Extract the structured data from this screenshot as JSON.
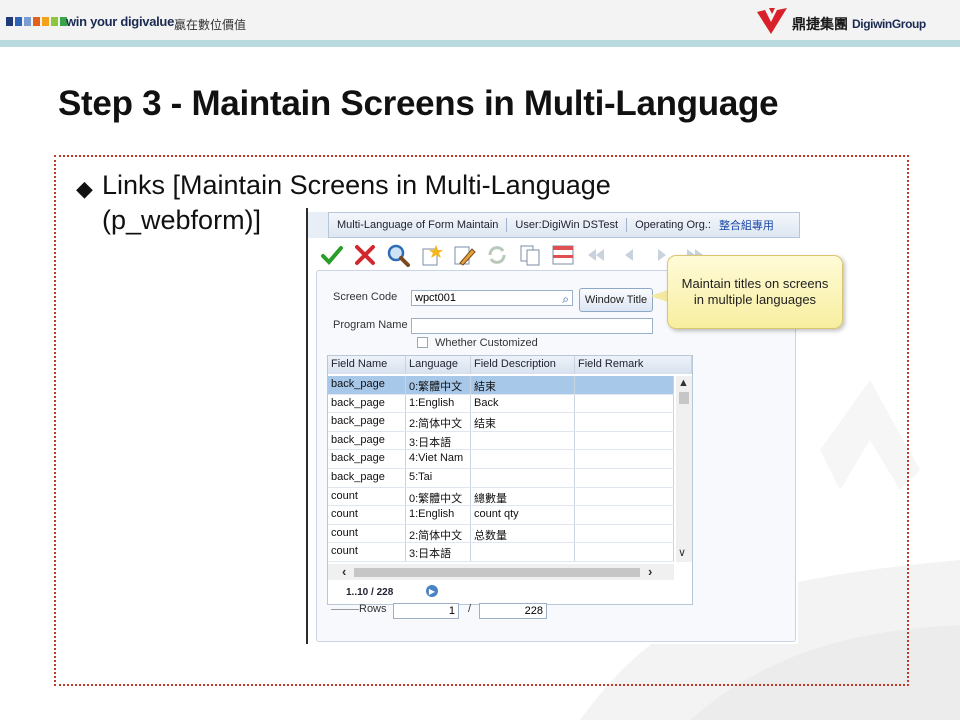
{
  "header": {
    "tagline": "win your digivalue",
    "tagline_cn": "贏在數位價值",
    "brand_cn": "鼎捷集團",
    "brand_en": "DigiwinGroup",
    "square_colors": [
      "#1e3a78",
      "#2f63b5",
      "#7a9ed3",
      "#e2611c",
      "#f4a21e",
      "#8cc63f",
      "#3ba34a"
    ]
  },
  "slide": {
    "title": "Step 3 - Maintain Screens in Multi-Language",
    "bullet_symbol": "◆",
    "bullet_text": "Links [Maintain Screens in Multi-Language (p_webform)]"
  },
  "app": {
    "header": {
      "title": "Multi-Language of Form Maintain",
      "user": "User:DigiWin DSTest",
      "org_label": "Operating Org.:",
      "org_value": "整合組專用"
    },
    "toolbar_icons": [
      "check-icon",
      "cross-icon",
      "search-icon",
      "new-icon",
      "edit-icon",
      "refresh-icon",
      "copy-icon",
      "grid-icon",
      "first-icon",
      "prev-icon",
      "next-icon",
      "last-icon"
    ],
    "form": {
      "screen_code_label": "Screen Code",
      "screen_code_value": "wpct001",
      "window_title_button": "Window Title",
      "program_name_label": "Program Name",
      "program_name_value": "",
      "customized_label": "Whether Customized"
    },
    "grid": {
      "columns": [
        "Field Name",
        "Language",
        "Field Description",
        "Field Remark"
      ],
      "rows": [
        {
          "field": "back_page",
          "lang": "0:繁體中文",
          "desc": "結束",
          "remark": ""
        },
        {
          "field": "back_page",
          "lang": "1:English",
          "desc": "Back",
          "remark": ""
        },
        {
          "field": "back_page",
          "lang": "2:简体中文",
          "desc": "结束",
          "remark": ""
        },
        {
          "field": "back_page",
          "lang": "3:日本語",
          "desc": "",
          "remark": ""
        },
        {
          "field": "back_page",
          "lang": "4:Viet Nam",
          "desc": "",
          "remark": ""
        },
        {
          "field": "back_page",
          "lang": "5:Tai",
          "desc": "",
          "remark": ""
        },
        {
          "field": "count",
          "lang": "0:繁體中文",
          "desc": "總數量",
          "remark": ""
        },
        {
          "field": "count",
          "lang": "1:English",
          "desc": "count qty",
          "remark": ""
        },
        {
          "field": "count",
          "lang": "2:简体中文",
          "desc": "总数量",
          "remark": ""
        },
        {
          "field": "count",
          "lang": "3:日本語",
          "desc": "",
          "remark": ""
        }
      ],
      "pager": "1..10 / 228"
    },
    "footer": {
      "rows_label": "Rows",
      "rows_value": "1",
      "separator": "/",
      "total_value": "228"
    }
  },
  "callout": {
    "text": "Maintain titles on screens in multiple languages"
  }
}
